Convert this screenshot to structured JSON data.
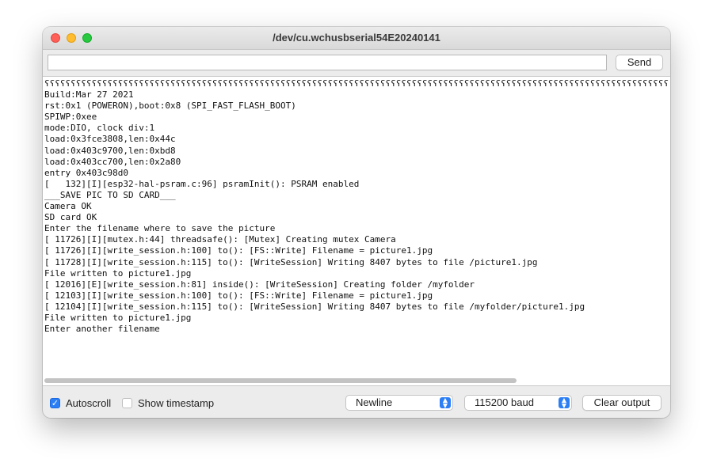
{
  "window": {
    "title": "/dev/cu.wchusbserial54E20240141"
  },
  "input": {
    "value": "",
    "send_label": "Send"
  },
  "output": {
    "lines": [
      "ʕʕʕʕʕʕʕʕʕʕʕʕʕʕʕʕʕʕʕʕʕʕʕʕʕʕʕʕʕʕʕʕʕʕʕʕʕʕʕʕʕʕʕʕʕʕʕʕʕʕʕʕʕʕʕʕʕʕʕʕʕʕʕʕʕʕʕʕʕʕʕʕʕʕʕʕʕʕʕʕʕʕʕʕʕʕʕʕʕʕʕʕʕʕʕʕʕʕʕʕʕʕʕʕʕʕʕʕʕʕʕʕʕʕʕʕʕʕʕʕʕʕʕʕʕʕ",
      "Build:Mar 27 2021",
      "rst:0x1 (POWERON),boot:0x8 (SPI_FAST_FLASH_BOOT)",
      "SPIWP:0xee",
      "mode:DIO, clock div:1",
      "load:0x3fce3808,len:0x44c",
      "load:0x403c9700,len:0xbd8",
      "load:0x403cc700,len:0x2a80",
      "entry 0x403c98d0",
      "[   132][I][esp32-hal-psram.c:96] psramInit(): PSRAM enabled",
      "___SAVE PIC TO SD CARD___",
      "Camera OK",
      "SD card OK",
      "Enter the filename where to save the picture",
      "[ 11726][I][mutex.h:44] threadsafe(): [Mutex] Creating mutex Camera",
      "[ 11726][I][write_session.h:100] to(): [FS::Write] Filename = picture1.jpg",
      "[ 11728][I][write_session.h:115] to(): [WriteSession] Writing 8407 bytes to file /picture1.jpg",
      "File written to picture1.jpg",
      "[ 12016][E][write_session.h:81] inside(): [WriteSession] Creating folder /myfolder",
      "[ 12103][I][write_session.h:100] to(): [FS::Write] Filename = picture1.jpg",
      "[ 12104][I][write_session.h:115] to(): [WriteSession] Writing 8407 bytes to file /myfolder/picture1.jpg",
      "File written to picture1.jpg",
      "Enter another filename"
    ]
  },
  "footer": {
    "autoscroll_label": "Autoscroll",
    "autoscroll_checked": true,
    "timestamp_label": "Show timestamp",
    "timestamp_checked": false,
    "line_ending": "Newline",
    "baud_rate": "115200 baud",
    "clear_label": "Clear output"
  },
  "colors": {
    "accent": "#2c7ef5"
  }
}
